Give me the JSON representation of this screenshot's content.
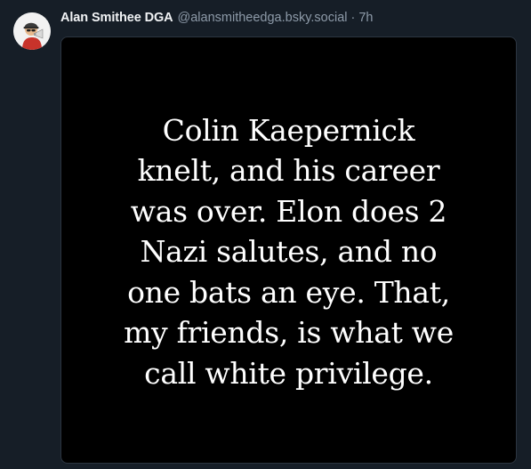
{
  "post": {
    "author": {
      "display_name": "Alan Smithee DGA",
      "handle": "@alansmitheedga.bsky.social"
    },
    "separator": "·",
    "time_ago": "7h",
    "image_text": "Colin Kaepernick\nknelt, and his career\nwas over. Elon does 2\nNazi salutes, and no\none bats an eye. That,\nmy friends, is what we\ncall white privilege."
  },
  "colors": {
    "background": "#161e27",
    "name": "#f1f3f5",
    "muted": "#8d9aa8",
    "image_background": "#000000",
    "image_text": "#ffffff"
  },
  "icons": {
    "avatar": "cartoon-director-megaphone-avatar"
  }
}
